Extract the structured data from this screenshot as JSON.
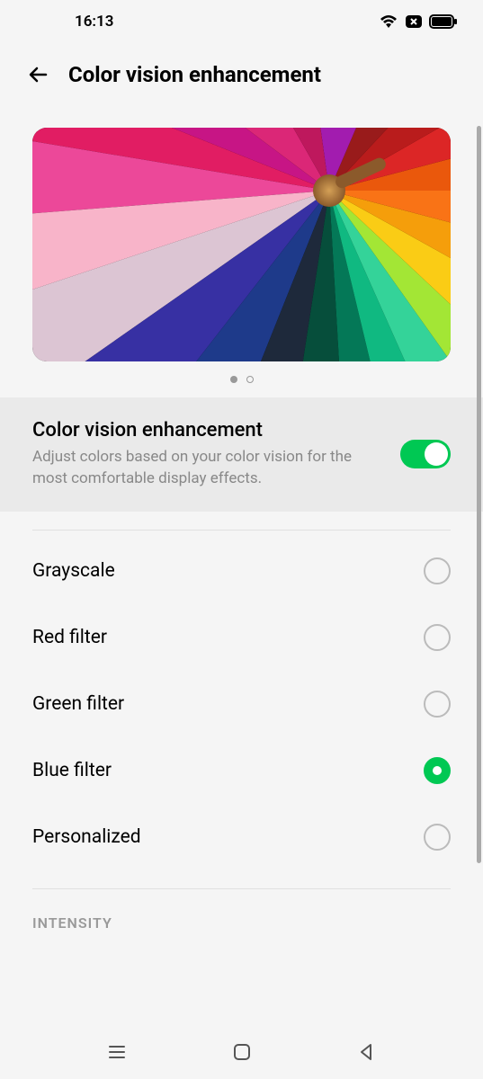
{
  "status": {
    "time": "16:13"
  },
  "header": {
    "title": "Color vision enhancement"
  },
  "carousel": {
    "active_index": 0,
    "total": 2
  },
  "toggle": {
    "title": "Color vision enhancement",
    "description": "Adjust colors based on your color vision for the most comfortable display effects.",
    "enabled": true
  },
  "options": [
    {
      "label": "Grayscale",
      "selected": false
    },
    {
      "label": "Red filter",
      "selected": false
    },
    {
      "label": "Green filter",
      "selected": false
    },
    {
      "label": "Blue filter",
      "selected": true
    },
    {
      "label": "Personalized",
      "selected": false
    }
  ],
  "section_header": "INTENSITY",
  "colors": {
    "accent": "#00c853"
  }
}
